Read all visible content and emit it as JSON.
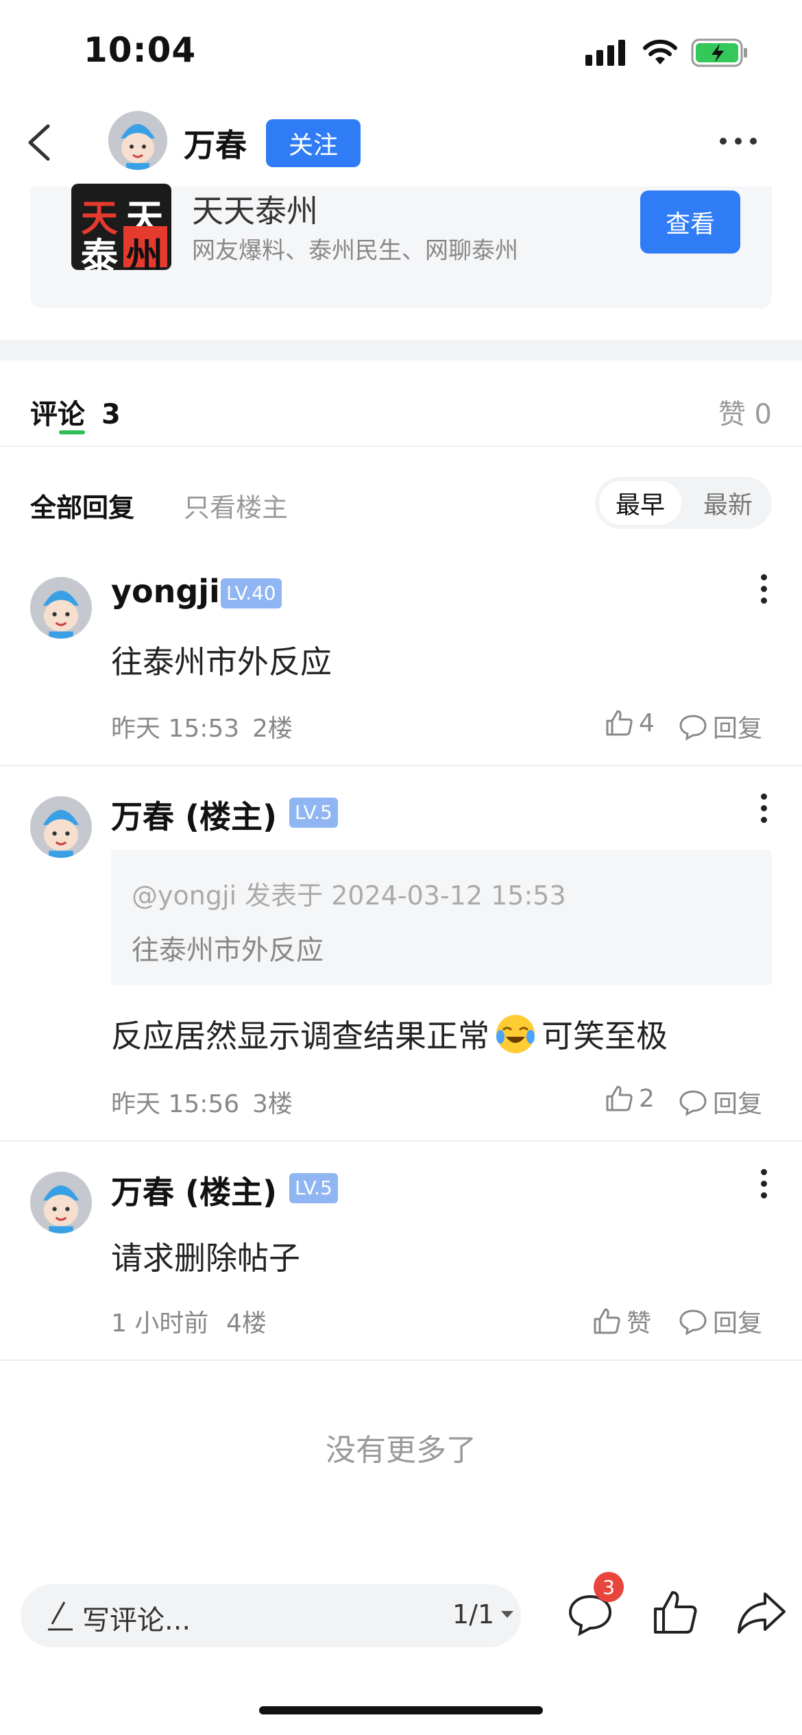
{
  "status": {
    "time": "10:04"
  },
  "header": {
    "author": "万春",
    "follow_label": "关注"
  },
  "card": {
    "title": "天天泰州",
    "subtitle": "网友爆料、泰州民生、网聊泰州",
    "button": "查看",
    "logo_chars": [
      "天",
      "天",
      "泰",
      "州"
    ]
  },
  "tabs": {
    "comments_label": "评论",
    "comments_count": "3",
    "likes_label": "赞 0"
  },
  "filters": {
    "all": "全部回复",
    "owner_only": "只看楼主",
    "earliest": "最早",
    "latest": "最新"
  },
  "comments": [
    {
      "name": "yongji",
      "level": "LV.40",
      "text": "往泰州市外反应",
      "time": "昨天 15:53",
      "floor": "2楼",
      "likes": "4",
      "reply": "回复"
    },
    {
      "name": "万春 (楼主)",
      "level": "LV.5",
      "quote_meta": "@yongji 发表于 2024-03-12 15:53",
      "quote_text": "往泰州市外反应",
      "text_before": "反应居然显示调查结果正常",
      "text_after": "可笑至极",
      "time": "昨天 15:56",
      "floor": "3楼",
      "likes": "2",
      "reply": "回复"
    },
    {
      "name": "万春 (楼主)",
      "level": "LV.5",
      "text": "请求删除帖子",
      "time": "1 小时前",
      "floor": "4楼",
      "likes": "赞",
      "reply": "回复"
    }
  ],
  "footer_note": "没有更多了",
  "bottom_bar": {
    "placeholder": "写评论...",
    "page": "1/1",
    "comment_badge": "3"
  },
  "colors": {
    "accent": "#2f7cf6",
    "tab_underline": "#2ebd59",
    "badge": "#e8453c",
    "level_badge": "#8fb5f3"
  }
}
